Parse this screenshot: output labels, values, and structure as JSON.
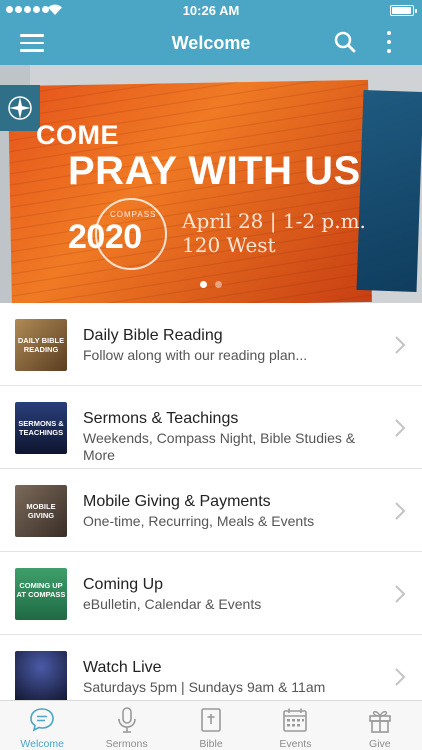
{
  "status_bar": {
    "time": "10:26 AM",
    "icons": [
      "signal-dots",
      "wifi-icon",
      "battery-icon"
    ]
  },
  "header": {
    "title": "Welcome",
    "menu_icon": "hamburger-icon",
    "search_icon": "search-icon",
    "more_icon": "more-vertical-icon",
    "color": "#4aa6c4"
  },
  "banner": {
    "line1": "COME",
    "line2": "PRAY WITH US",
    "badge_small": "COMPASS",
    "badge_year": "2020",
    "date": "April 28 | 1-2 p.m.",
    "location": "120 West",
    "carousel": {
      "count": 2,
      "active": 0
    }
  },
  "items": [
    {
      "title": "Daily Bible Reading",
      "subtitle": "Follow along with our reading plan...",
      "thumb_text": "DAILY BIBLE READING",
      "thumb_color": "#8a6a3e"
    },
    {
      "title": "Sermons & Teachings",
      "subtitle": "Weekends, Compass Night, Bible Studies & More",
      "thumb_text": "SERMONS & TEACHINGS",
      "thumb_color": "#1f2a4a"
    },
    {
      "title": "Mobile Giving & Payments",
      "subtitle": "One-time, Recurring, Meals & Events",
      "thumb_text": "MOBILE GIVING",
      "thumb_color": "#5a4a3e"
    },
    {
      "title": "Coming Up",
      "subtitle": "eBulletin, Calendar & Events",
      "thumb_text": "COMING UP AT COMPASS",
      "thumb_color": "#2e8a5a"
    },
    {
      "title": "Watch Live",
      "subtitle": "Saturdays 5pm | Sundays 9am & 11am",
      "thumb_text": "",
      "thumb_color": "#1c2240"
    }
  ],
  "tabs": [
    {
      "label": "Welcome",
      "icon": "chat-bubble-icon",
      "active": true
    },
    {
      "label": "Sermons",
      "icon": "microphone-icon",
      "active": false
    },
    {
      "label": "Bible",
      "icon": "bible-icon",
      "active": false
    },
    {
      "label": "Events",
      "icon": "calendar-icon",
      "active": false
    },
    {
      "label": "Give",
      "icon": "gift-icon",
      "active": false
    }
  ]
}
